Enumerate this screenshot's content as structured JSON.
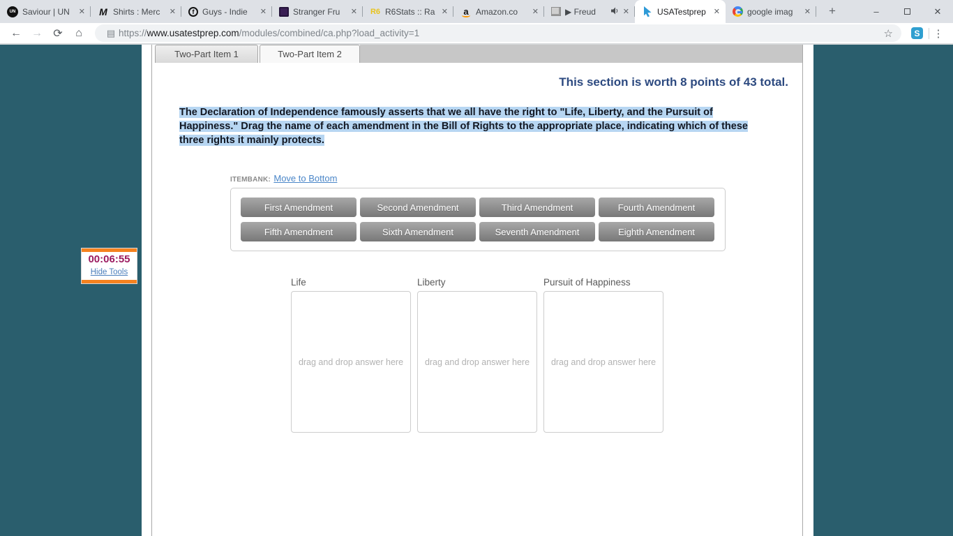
{
  "browser": {
    "tabs": [
      {
        "title": "Saviour | UN",
        "icon": "unfd-logo-icon",
        "favicon_text": "UN"
      },
      {
        "title": "Shirts : Merc",
        "icon": "merch-logo-icon",
        "favicon_text": "M"
      },
      {
        "title": "Guys - Indie",
        "icon": "guys-logo-icon",
        "favicon_text": "f"
      },
      {
        "title": "Stranger Fru",
        "icon": "stranger-logo-icon",
        "favicon_text": ""
      },
      {
        "title": "R6Stats :: Ra",
        "icon": "r6stats-logo-icon",
        "favicon_text": "R6"
      },
      {
        "title": "Amazon.co",
        "icon": "amazon-logo-icon",
        "favicon_text": "a"
      },
      {
        "title": "▶ Freud",
        "icon": "video-thumbnail-icon",
        "favicon_text": "",
        "audio_playing": true
      },
      {
        "title": "USATestprep",
        "icon": "usatestprep-cursor-icon",
        "favicon_text": "",
        "active": true
      },
      {
        "title": "google imag",
        "icon": "google-g-icon",
        "favicon_text": ""
      }
    ],
    "new_tab_label": "+",
    "window_controls": {
      "minimize": "–",
      "close": "✕"
    },
    "close_tab_glyph": "✕",
    "toolbar": {
      "back": "←",
      "forward": "→",
      "refresh": "⟳",
      "home": "⌂",
      "page_icon": "▤",
      "star": "☆",
      "extension_letter": "S",
      "menu": "⋮"
    },
    "address": {
      "scheme": "https://",
      "host": "www.usatestprep.com",
      "path": "/modules/combined/ca.php?load_activity=1"
    }
  },
  "content": {
    "item_tabs": [
      {
        "label": "Two-Part Item 1"
      },
      {
        "label": "Two-Part Item 2"
      }
    ],
    "section_note": "This section is worth 8 points of 43 total.",
    "question": "The Declaration of Independence famously asserts that we all have the right to \"Life, Liberty, and the Pursuit of Happiness.\" Drag the name of each amendment in the Bill of Rights to the appropriate place, indicating which of these three rights it mainly protects.",
    "itembank": {
      "label": "ITEMBANK:",
      "move_link": "Move to Bottom",
      "items": [
        "First Amendment",
        "Second Amendment",
        "Third Amendment",
        "Fourth Amendment",
        "Fifth Amendment",
        "Sixth Amendment",
        "Seventh Amendment",
        "Eighth Amendment"
      ]
    },
    "dropzones": [
      {
        "label": "Life",
        "placeholder": "drag and drop answer here"
      },
      {
        "label": "Liberty",
        "placeholder": "drag and drop answer here"
      },
      {
        "label": "Pursuit of Happiness",
        "placeholder": "drag and drop answer here"
      }
    ]
  },
  "tools": {
    "timer": "00:06:55",
    "hide_link": "Hide Tools"
  },
  "colors": {
    "teal_background": "#2a5e6d",
    "accent_orange": "#f5821f",
    "timer_text": "#9b1b60",
    "link_blue": "#4a86c8",
    "section_blue": "#2d4a80",
    "highlight_blue": "#b7d6f2"
  }
}
